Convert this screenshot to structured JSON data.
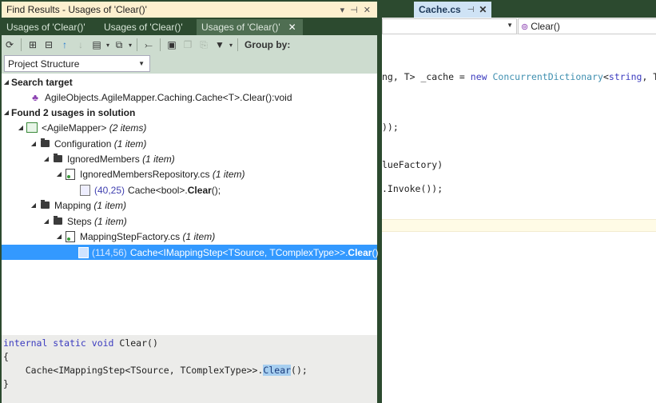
{
  "panel": {
    "title": "Find Results - Usages of 'Clear()'",
    "controls": {
      "dropdown": "▾",
      "pin": "⊣",
      "close": "✕"
    },
    "tabs": [
      {
        "label": "Usages of 'Clear()'",
        "active": false
      },
      {
        "label": "Usages of 'Clear()'",
        "active": false
      },
      {
        "label": "Usages of 'Clear()'",
        "active": true,
        "close": "✕"
      }
    ],
    "toolbar": {
      "icons": [
        "refresh-icon",
        "expand-all-icon",
        "collapse-all-icon",
        "previous-icon",
        "next-icon",
        "preview-icon",
        "export-icon",
        "merge-icon",
        "pin-results-icon",
        "copy-icon",
        "paste-icon",
        "filter-icon"
      ],
      "group_by_label": "Group by:"
    },
    "group_by": {
      "value": "Project Structure"
    },
    "tree": {
      "search_target_label": "Search target",
      "search_target_value": "AgileObjects.AgileMapper.Caching.Cache<T>.Clear():void",
      "found_label": "Found 2 usages in solution",
      "project": {
        "name": "<AgileMapper>",
        "count": "(2 items)"
      },
      "folder_configuration": {
        "name": "Configuration",
        "count": "(1 item)"
      },
      "folder_ignored": {
        "name": "IgnoredMembers",
        "count": "(1 item)"
      },
      "file_ignored": {
        "name": "IgnoredMembersRepository.cs",
        "count": "(1 item)"
      },
      "usage1": {
        "coord": "(40,25)",
        "prefix": "Cache<bool>.",
        "method": "Clear",
        "suffix": "();"
      },
      "folder_mapping": {
        "name": "Mapping",
        "count": "(1 item)"
      },
      "folder_steps": {
        "name": "Steps",
        "count": "(1 item)"
      },
      "file_mapping": {
        "name": "MappingStepFactory.cs",
        "count": "(1 item)"
      },
      "usage2": {
        "coord": "(114,56)",
        "prefix": "Cache<IMappingStep<TSource, TComplexType>>.",
        "method": "Clear",
        "suffix": "();"
      }
    },
    "preview": {
      "line1_kw": "internal static void",
      "line1_rest": " Clear()",
      "line2": "{",
      "line3_pre": "    Cache<IMappingStep<TSource, TComplexType>>.",
      "line3_hl": "Clear",
      "line3_post": "();",
      "line4": "}"
    }
  },
  "editor": {
    "tab": {
      "label": "Cache.cs",
      "pin": "⊣",
      "close": "✕"
    },
    "member_dropdown": "Clear()",
    "code": {
      "l1_a": "ng, T> _cache = ",
      "l1_kw": "new",
      "l1_ty": " ConcurrentDictionary",
      "l1_b": "<",
      "l1_kw2": "string",
      "l1_c": ", T>",
      "l2": "));",
      "l3": "lueFactory)",
      "l4": ".Invoke());"
    }
  }
}
